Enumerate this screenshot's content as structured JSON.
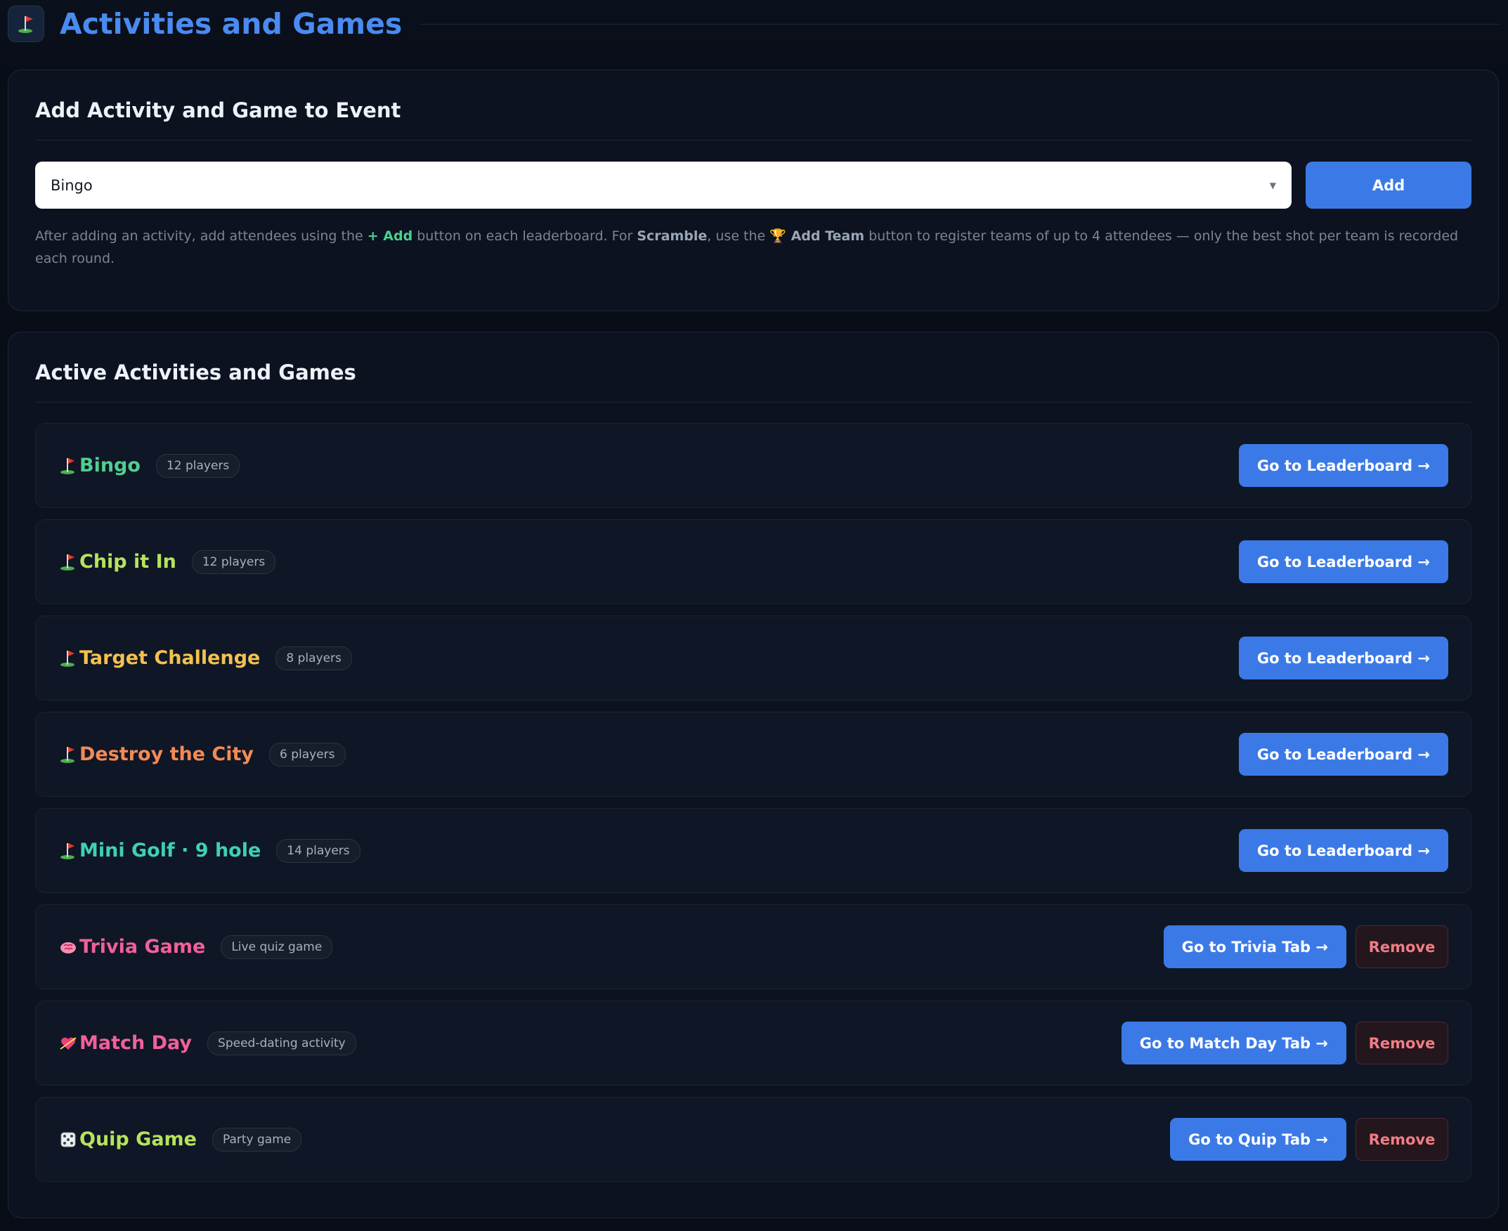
{
  "header": {
    "title": "Activities and Games",
    "icon": "golf-flag-icon"
  },
  "add_panel": {
    "title": "Add Activity and Game to Event",
    "select_value": "Bingo",
    "add_label": "Add",
    "help": {
      "part1": "After adding an activity, add attendees using the ",
      "add_hint": "+ Add",
      "part2": " button on each leaderboard. For ",
      "scramble": "Scramble",
      "part3": ", use the ",
      "trophy": "🏆",
      "add_team": " Add Team",
      "part4": " button to register teams of up to 4 attendees — only the best shot per team is recorded each round."
    }
  },
  "active_panel": {
    "title": "Active Activities and Games",
    "items": [
      {
        "icon": "golf-flag-icon",
        "name": "Bingo",
        "badge": "12 players",
        "color": "#4fcf8f",
        "action": "Go to Leaderboard →",
        "removable": false
      },
      {
        "icon": "golf-flag-icon",
        "name": "Chip it In",
        "badge": "12 players",
        "color": "#b6e35b",
        "action": "Go to Leaderboard →",
        "removable": false
      },
      {
        "icon": "golf-flag-icon",
        "name": "Target Challenge",
        "badge": "8 players",
        "color": "#f2c14f",
        "action": "Go to Leaderboard →",
        "removable": false
      },
      {
        "icon": "golf-flag-icon",
        "name": "Destroy the City",
        "badge": "6 players",
        "color": "#f28a55",
        "action": "Go to Leaderboard →",
        "removable": false
      },
      {
        "icon": "golf-flag-icon",
        "name": "Mini Golf · 9 hole",
        "badge": "14 players",
        "color": "#3fd0b2",
        "action": "Go to Leaderboard →",
        "removable": false
      },
      {
        "icon": "brain-icon",
        "name": "Trivia Game",
        "badge": "Live quiz game",
        "color": "#f0609b",
        "action": "Go to Trivia Tab →",
        "removable": true
      },
      {
        "icon": "heart-arrow-icon",
        "name": "Match Day",
        "badge": "Speed-dating activity",
        "color": "#f0609b",
        "action": "Go to Match Day Tab →",
        "removable": true
      },
      {
        "icon": "dice-icon",
        "name": "Quip Game",
        "badge": "Party game",
        "color": "#b6e35b",
        "action": "Go to Quip Tab →",
        "removable": true
      }
    ],
    "remove_label": "Remove"
  },
  "colors": {
    "accent": "#3b7ae6",
    "title_blue": "#4a8bf1",
    "background": "#080d18",
    "panel": "#0c1220",
    "remove_text": "#f07d86"
  }
}
